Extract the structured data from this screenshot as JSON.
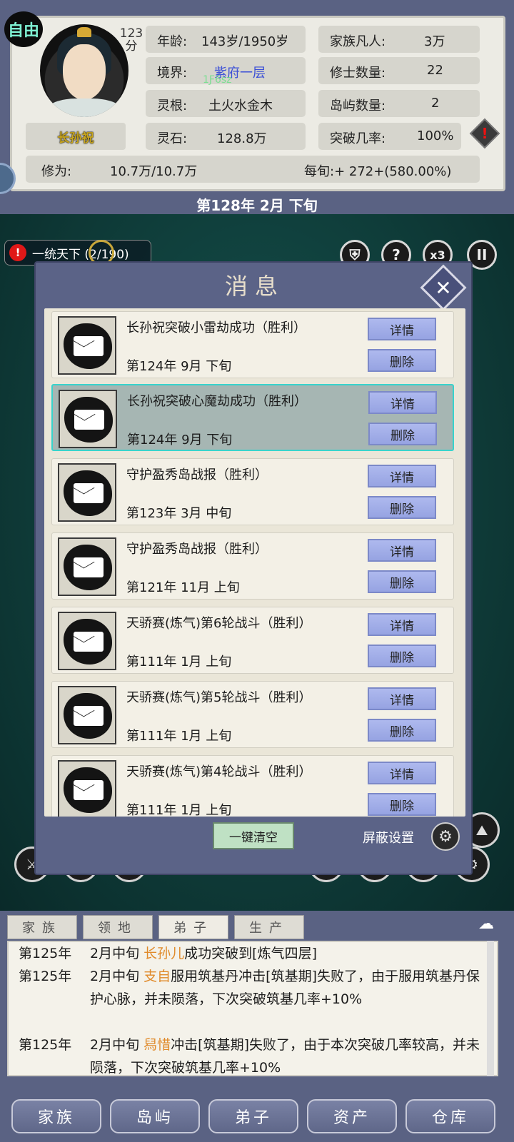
{
  "header": {
    "status_badge": "自由",
    "score_num": "123",
    "score_unit": "分",
    "name": "长孙祝",
    "age_label": "年龄:",
    "age_value": "143岁/1950岁",
    "realm_label": "境界:",
    "realm_value": "紫府一层",
    "realm_sub": "1Ƒ6sz",
    "root_label": "灵根:",
    "root_value": "土火水金木",
    "stone_label": "灵石:",
    "stone_value": "128.8万",
    "mortals_label": "家族凡人:",
    "mortals_value": "3万",
    "cultivators_label": "修士数量:",
    "cultivators_value": "22",
    "islands_label": "岛屿数量:",
    "islands_value": "2",
    "breakthrough_label": "突破几率:",
    "breakthrough_value": "100%",
    "cultivation_label": "修为:",
    "cultivation_value": "10.7万/10.7万",
    "per_period": "每旬:+ 272+(580.00%)",
    "date": "第128年 2月 下旬"
  },
  "quest": {
    "label": "一统天下 (2/190)"
  },
  "top_buttons": {
    "help": "?",
    "speed": "x3",
    "pause": "II"
  },
  "modal": {
    "title": "消息",
    "detail_label": "详情",
    "delete_label": "删除",
    "clear_all": "一键清空",
    "block_settings": "屏蔽设置",
    "messages": [
      {
        "title": "长孙祝突破小雷劫成功（胜利）",
        "date": "第124年 9月 下旬"
      },
      {
        "title": "长孙祝突破心魔劫成功（胜利）",
        "date": "第124年 9月 下旬"
      },
      {
        "title": "守护盈秀岛战报（胜利）",
        "date": "第123年 3月 中旬"
      },
      {
        "title": "守护盈秀岛战报（胜利）",
        "date": "第121年 11月 上旬"
      },
      {
        "title": "天骄赛(炼气)第6轮战斗（胜利）",
        "date": "第111年 1月 上旬"
      },
      {
        "title": "天骄赛(炼气)第5轮战斗（胜利）",
        "date": "第111年 1月 上旬"
      },
      {
        "title": "天骄赛(炼气)第4轮战斗（胜利）",
        "date": "第111年 1月 上旬"
      }
    ]
  },
  "log_tabs": [
    "家族",
    "领地",
    "弟子",
    "生产"
  ],
  "log": {
    "l1_year": "第125年",
    "l1_pre": "2月中旬 ",
    "l1_name": "长孙儿",
    "l1_post": "成功突破到[炼气四层]",
    "l2_year": "第125年",
    "l2_pre": "2月中旬 ",
    "l2_name": "支自",
    "l2_post": "服用筑基丹冲击[筑基期]失败了，由于服用筑基丹保护心脉，并未陨落，下次突破筑基几率+10%",
    "l3_year": "第125年",
    "l3_pre": "2月中旬 ",
    "l3_name": "舄惜",
    "l3_post": "冲击[筑基期]失败了，由于本次突破几率较高，并未陨落，下次突破筑基几率+10%"
  },
  "nav": [
    "家族",
    "岛屿",
    "弟子",
    "资产",
    "仓库"
  ],
  "colors": {
    "frame": "#5a6283",
    "highlight_name": "#e08a2a",
    "selected_border": "#38d3cc",
    "button_blue": "#aeb9ee"
  },
  "icons": [
    "envelope-icon",
    "close-icon",
    "gear-icon",
    "warning-icon",
    "pause-icon",
    "help-icon"
  ]
}
